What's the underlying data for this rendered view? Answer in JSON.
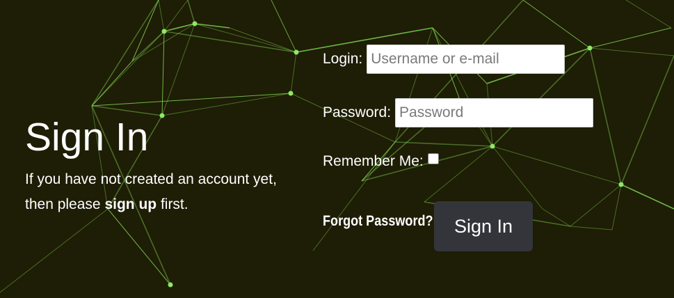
{
  "intro": {
    "title": "Sign In",
    "text_before": "If you have not created an account yet, then please ",
    "signup_link": "sign up",
    "text_after": " first."
  },
  "form": {
    "login_label": "Login:",
    "login_placeholder": "Username or e-mail",
    "password_label": "Password:",
    "password_placeholder": "Password",
    "remember_label": "Remember Me:",
    "remember_checked": false,
    "forgot_link": "Forgot Password?",
    "submit_label": "Sign In"
  },
  "colors": {
    "background": "#1e1d05",
    "network_line": "#7fd255",
    "network_node": "#8ee865",
    "button": "#33353b"
  }
}
